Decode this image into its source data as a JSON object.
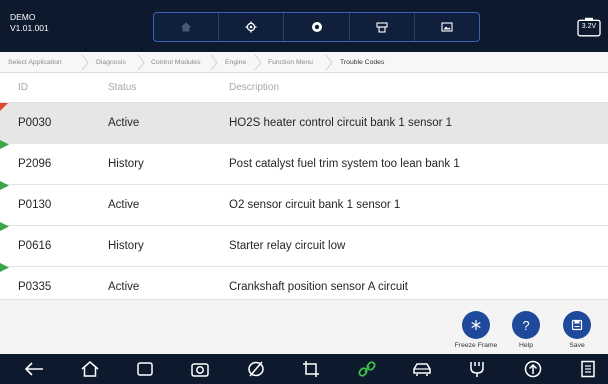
{
  "header": {
    "brand_line1": "DEMO",
    "brand_line2": "V1.01.001",
    "battery": "3.2V",
    "toolbar": [
      {
        "icon": "home-icon"
      },
      {
        "icon": "gear-icon"
      },
      {
        "icon": "record-icon"
      },
      {
        "icon": "print-icon"
      },
      {
        "icon": "screenshot-icon"
      }
    ]
  },
  "breadcrumb": [
    "Select Application",
    "Diagnosis",
    "Control Modules",
    "Engine",
    "Function Menu",
    "Trouble Codes"
  ],
  "table": {
    "columns": {
      "id": "ID",
      "status": "Status",
      "description": "Description"
    },
    "rows": [
      {
        "id": "P0030",
        "status": "Active",
        "description": "HO2S heater control circuit bank 1  sensor 1",
        "selected": true
      },
      {
        "id": "P2096",
        "status": "History",
        "description": "Post catalyst fuel trim system too lean bank 1",
        "selected": false
      },
      {
        "id": "P0130",
        "status": "Active",
        "description": "O2 sensor circuit bank 1 sensor 1",
        "selected": false
      },
      {
        "id": "P0616",
        "status": "History",
        "description": "Starter relay circuit low",
        "selected": false
      },
      {
        "id": "P0335",
        "status": "Active",
        "description": "Crankshaft position sensor A circuit",
        "selected": false
      }
    ]
  },
  "actions": {
    "freeze_frame": "Freeze Frame",
    "help": "Help",
    "save": "Save"
  },
  "navbar": [
    "back-icon",
    "home-icon",
    "recent-apps-icon",
    "camera-icon",
    "browser-icon",
    "crop-icon",
    "link-icon",
    "vehicle-icon",
    "vci-icon",
    "upload-icon",
    "document-icon"
  ],
  "colors": {
    "topbar": "#0d1a2e",
    "accent": "#1f4a9c",
    "marker_red": "#e0492c",
    "marker_green": "#3aa64a"
  }
}
